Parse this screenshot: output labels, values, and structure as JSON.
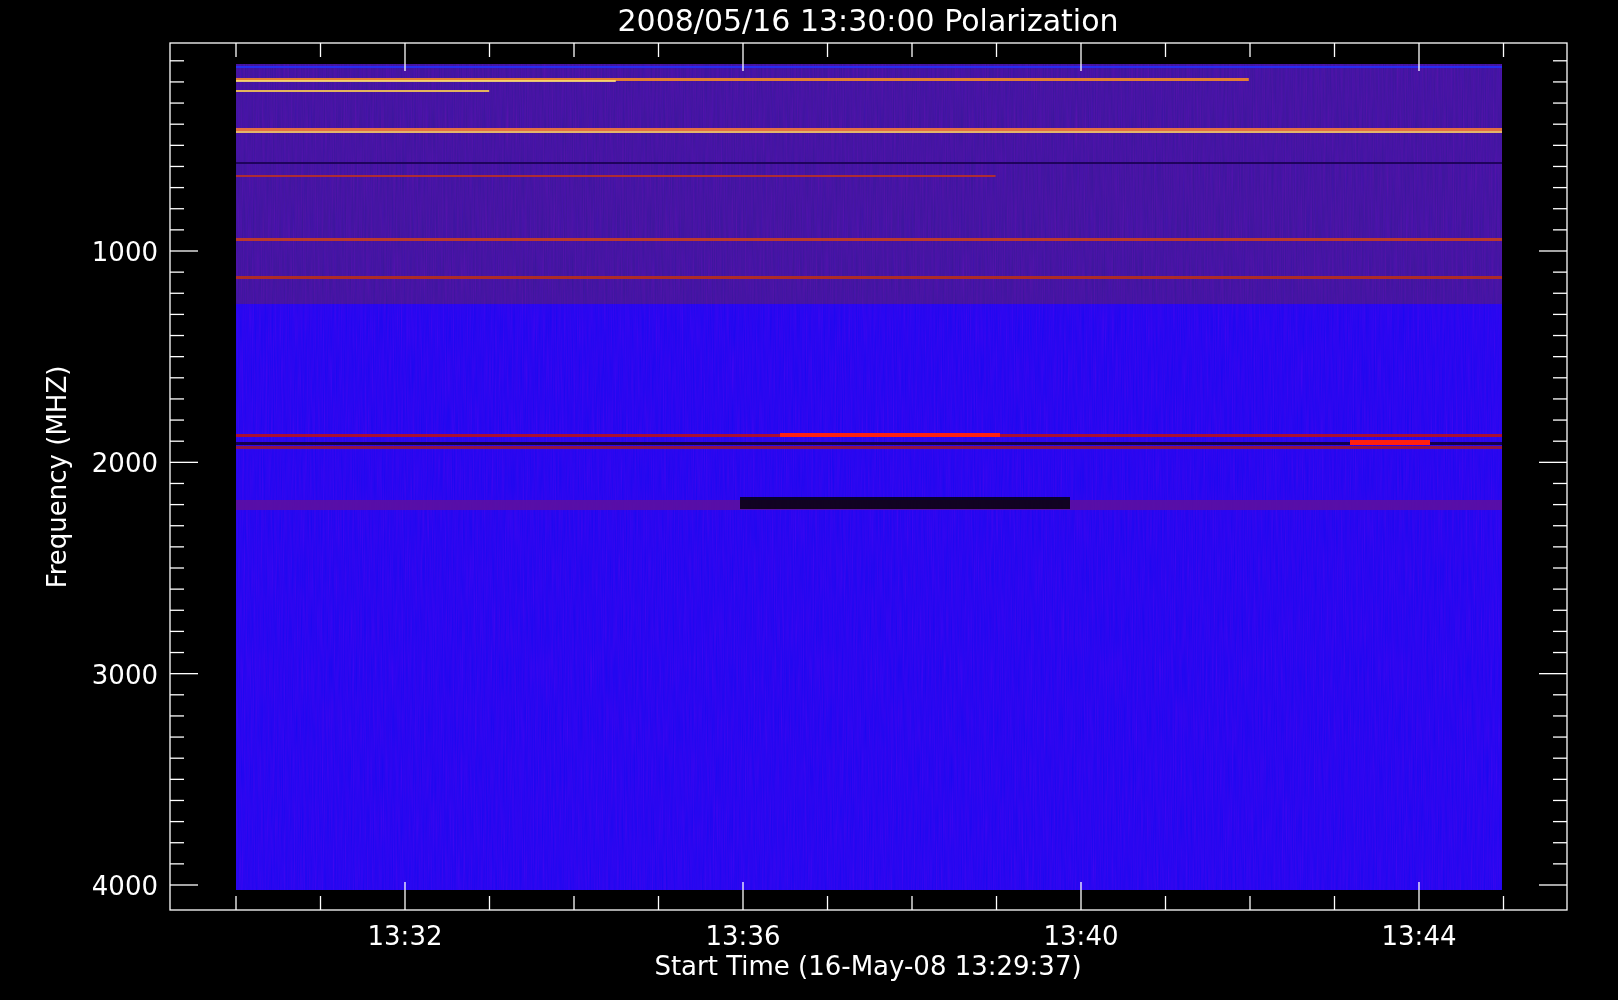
{
  "title": "2008/05/16 13:30:00 Polarization",
  "y_axis": {
    "label": "Frequency (MHZ)",
    "ticks": [
      "1000",
      "2000",
      "3000",
      "4000"
    ]
  },
  "x_axis": {
    "label": "Start Time (16-May-08 13:29:37)",
    "ticks": [
      "13:32",
      "13:36",
      "13:40",
      "13:44"
    ]
  }
}
